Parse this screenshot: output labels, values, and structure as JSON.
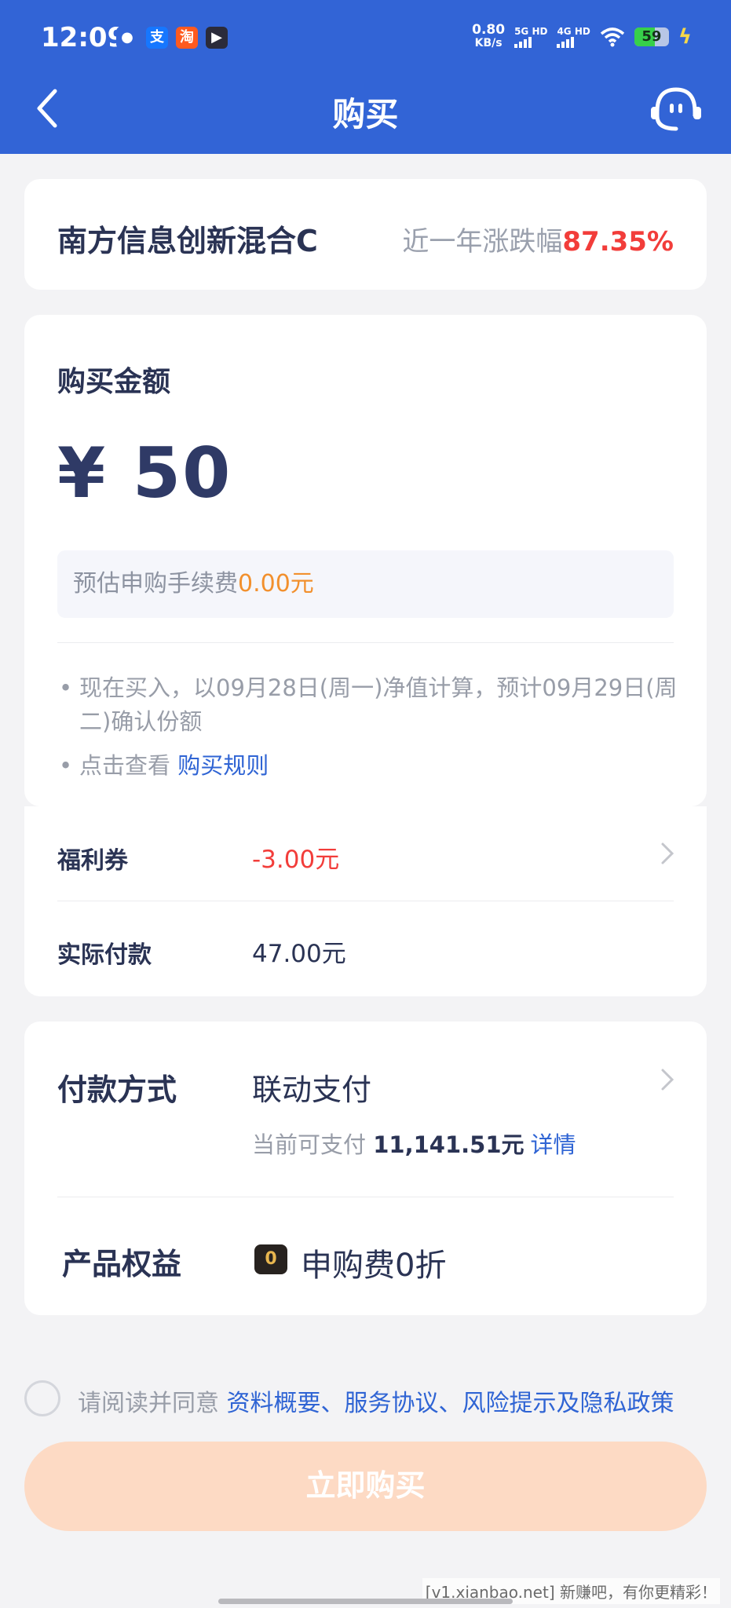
{
  "status_bar": {
    "time": "12:09",
    "apps": [
      "wechat-icon",
      "alipay-icon",
      "taobao-icon",
      "video-app-icon"
    ],
    "speed_value": "0.80",
    "speed_unit": "KB/s",
    "net1": "5G HD",
    "net2": "4G HD",
    "battery": "59",
    "battery_level": 0.59
  },
  "header": {
    "title": "购买"
  },
  "fund": {
    "name": "南方信息创新混合C",
    "change_label": "近一年涨跌幅",
    "change_value": "87.35%"
  },
  "amount": {
    "label": "购买金额",
    "value": "¥ 50",
    "fee_label": "预估申购手续费",
    "fee_value": "0.00元",
    "note1": "现在买入，以09月28日(周一)净值计算，预计09月29日(周二)确认份额",
    "note2_prefix": "点击查看 ",
    "note2_link": "购买规则"
  },
  "coupon": {
    "coupon_label": "福利券",
    "coupon_value": "-3.00元",
    "actual_label": "实际付款",
    "actual_value": "47.00元"
  },
  "payment": {
    "label": "付款方式",
    "method": "联动支付",
    "available_prefix": "当前可支付 ",
    "available_value": "11,141.51元",
    "detail_link": "详情",
    "benefit_label": "产品权益",
    "benefit_icon_text": "0折",
    "benefit_text": "申购费0折"
  },
  "agreement": {
    "prefix": "请阅读并同意 ",
    "link": "资料概要、服务协议、风险提示及隐私政策"
  },
  "buy_button": "立即购买",
  "watermark": "[v1.xianbao.net] 新赚吧，有你更精彩！",
  "colors": {
    "brand_blue": "#3264d6",
    "link_blue": "#2f64d4",
    "red": "#f23d3a",
    "orange": "#f2902d",
    "button_disabled": "#fddac4"
  }
}
